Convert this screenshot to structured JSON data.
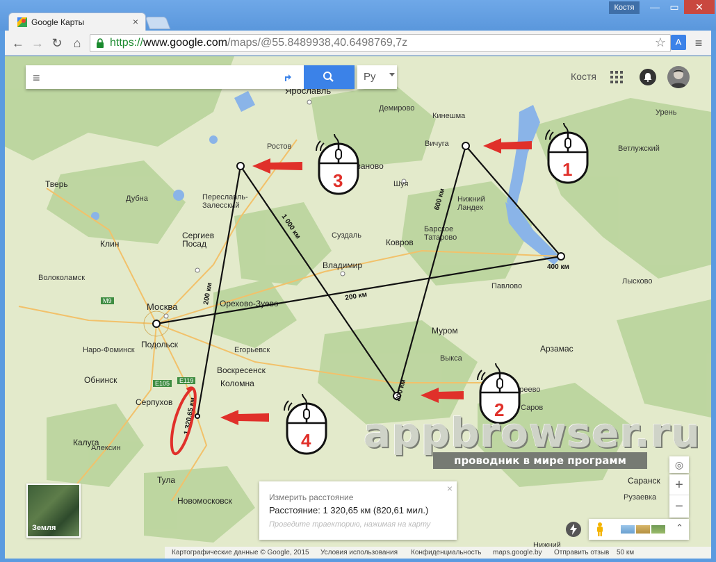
{
  "browser": {
    "tab_title": "Google Карты",
    "tab_close": "×",
    "user_badge": "Костя",
    "window_min": "—",
    "window_max": "▭",
    "window_close": "✕",
    "url_scheme": "https://",
    "url_host": "www.google.com",
    "url_path": "/maps/@55.8489938,40.6498769,7z"
  },
  "maps": {
    "search_placeholder": "",
    "language": "Ру",
    "account_name": "Костя",
    "earth_label": "Земля",
    "measure": {
      "heading": "Измерить расстояние",
      "value": "Расстояние: 1 320,65 км (820,61 мил.)",
      "hint": "Проведите траекторию, нажимая на карту"
    },
    "footer": {
      "copyright": "Картографические данные © Google, 2015",
      "terms": "Условия использования",
      "privacy": "Конфиденциальность",
      "domain": "maps.google.by",
      "feedback": "Отправить отзыв",
      "scale": "50 км"
    }
  },
  "places": [
    {
      "name": "Ярославль",
      "cls": "big"
    },
    {
      "name": "Демирово",
      "cls": ""
    },
    {
      "name": "Кинешма",
      "cls": ""
    },
    {
      "name": "Ростов",
      "cls": ""
    },
    {
      "name": "Вичуга",
      "cls": ""
    },
    {
      "name": "Иваново",
      "cls": "city"
    },
    {
      "name": "Тверь",
      "cls": "city"
    },
    {
      "name": "Дубна",
      "cls": ""
    },
    {
      "name": "Переславль-Залесский",
      "cls": ""
    },
    {
      "name": "Шуя",
      "cls": ""
    },
    {
      "name": "Нижний Ландех",
      "cls": ""
    },
    {
      "name": "Урень",
      "cls": ""
    },
    {
      "name": "Ветлужский",
      "cls": ""
    },
    {
      "name": "Сергиев Посад",
      "cls": "city"
    },
    {
      "name": "Клин",
      "cls": "city"
    },
    {
      "name": "Суздаль",
      "cls": ""
    },
    {
      "name": "Ковров",
      "cls": "city"
    },
    {
      "name": "Барское Татарово",
      "cls": ""
    },
    {
      "name": "Владимир",
      "cls": "city"
    },
    {
      "name": "Волоколамск",
      "cls": ""
    },
    {
      "name": "Москва",
      "cls": "big"
    },
    {
      "name": "Орехово-Зуево",
      "cls": "city"
    },
    {
      "name": "Павлово",
      "cls": ""
    },
    {
      "name": "Лысково",
      "cls": ""
    },
    {
      "name": "Наро-Фоминск",
      "cls": ""
    },
    {
      "name": "Подольск",
      "cls": "city"
    },
    {
      "name": "Муром",
      "cls": "city"
    },
    {
      "name": "Арзамас",
      "cls": "city"
    },
    {
      "name": "Егорьевск",
      "cls": ""
    },
    {
      "name": "Обнинск",
      "cls": "city"
    },
    {
      "name": "Воскресенск",
      "cls": "city"
    },
    {
      "name": "Выкса",
      "cls": ""
    },
    {
      "name": "Коломна",
      "cls": "city"
    },
    {
      "name": "Серпухов",
      "cls": "city"
    },
    {
      "name": "Калуга",
      "cls": "city"
    },
    {
      "name": "Алексин",
      "cls": ""
    },
    {
      "name": "Тула",
      "cls": "city"
    },
    {
      "name": "Новомосковск",
      "cls": "city"
    },
    {
      "name": "Саранск",
      "cls": "city"
    },
    {
      "name": "Рузаевка",
      "cls": ""
    },
    {
      "name": "Саров",
      "cls": ""
    },
    {
      "name": "Нижний",
      "cls": ""
    },
    {
      "name": "Бреево",
      "cls": ""
    }
  ],
  "road_labels": [
    "M9",
    "E105",
    "E119"
  ],
  "segment_labels": [
    "1 000 км",
    "600 км",
    "400 км",
    "200 км",
    "200 км",
    "800 км",
    "1 320,65 км"
  ],
  "mouse_numbers": [
    "1",
    "2",
    "3",
    "4"
  ],
  "watermark": {
    "brand": "appbrowser.ru",
    "tagline": "проводник в мире программ"
  },
  "colors": {
    "map_land": "#dfe8c4",
    "forest": "#b9d49c",
    "water": "#8ab4e8",
    "accent_red": "#e0302a",
    "search_blue": "#3b82e8"
  }
}
